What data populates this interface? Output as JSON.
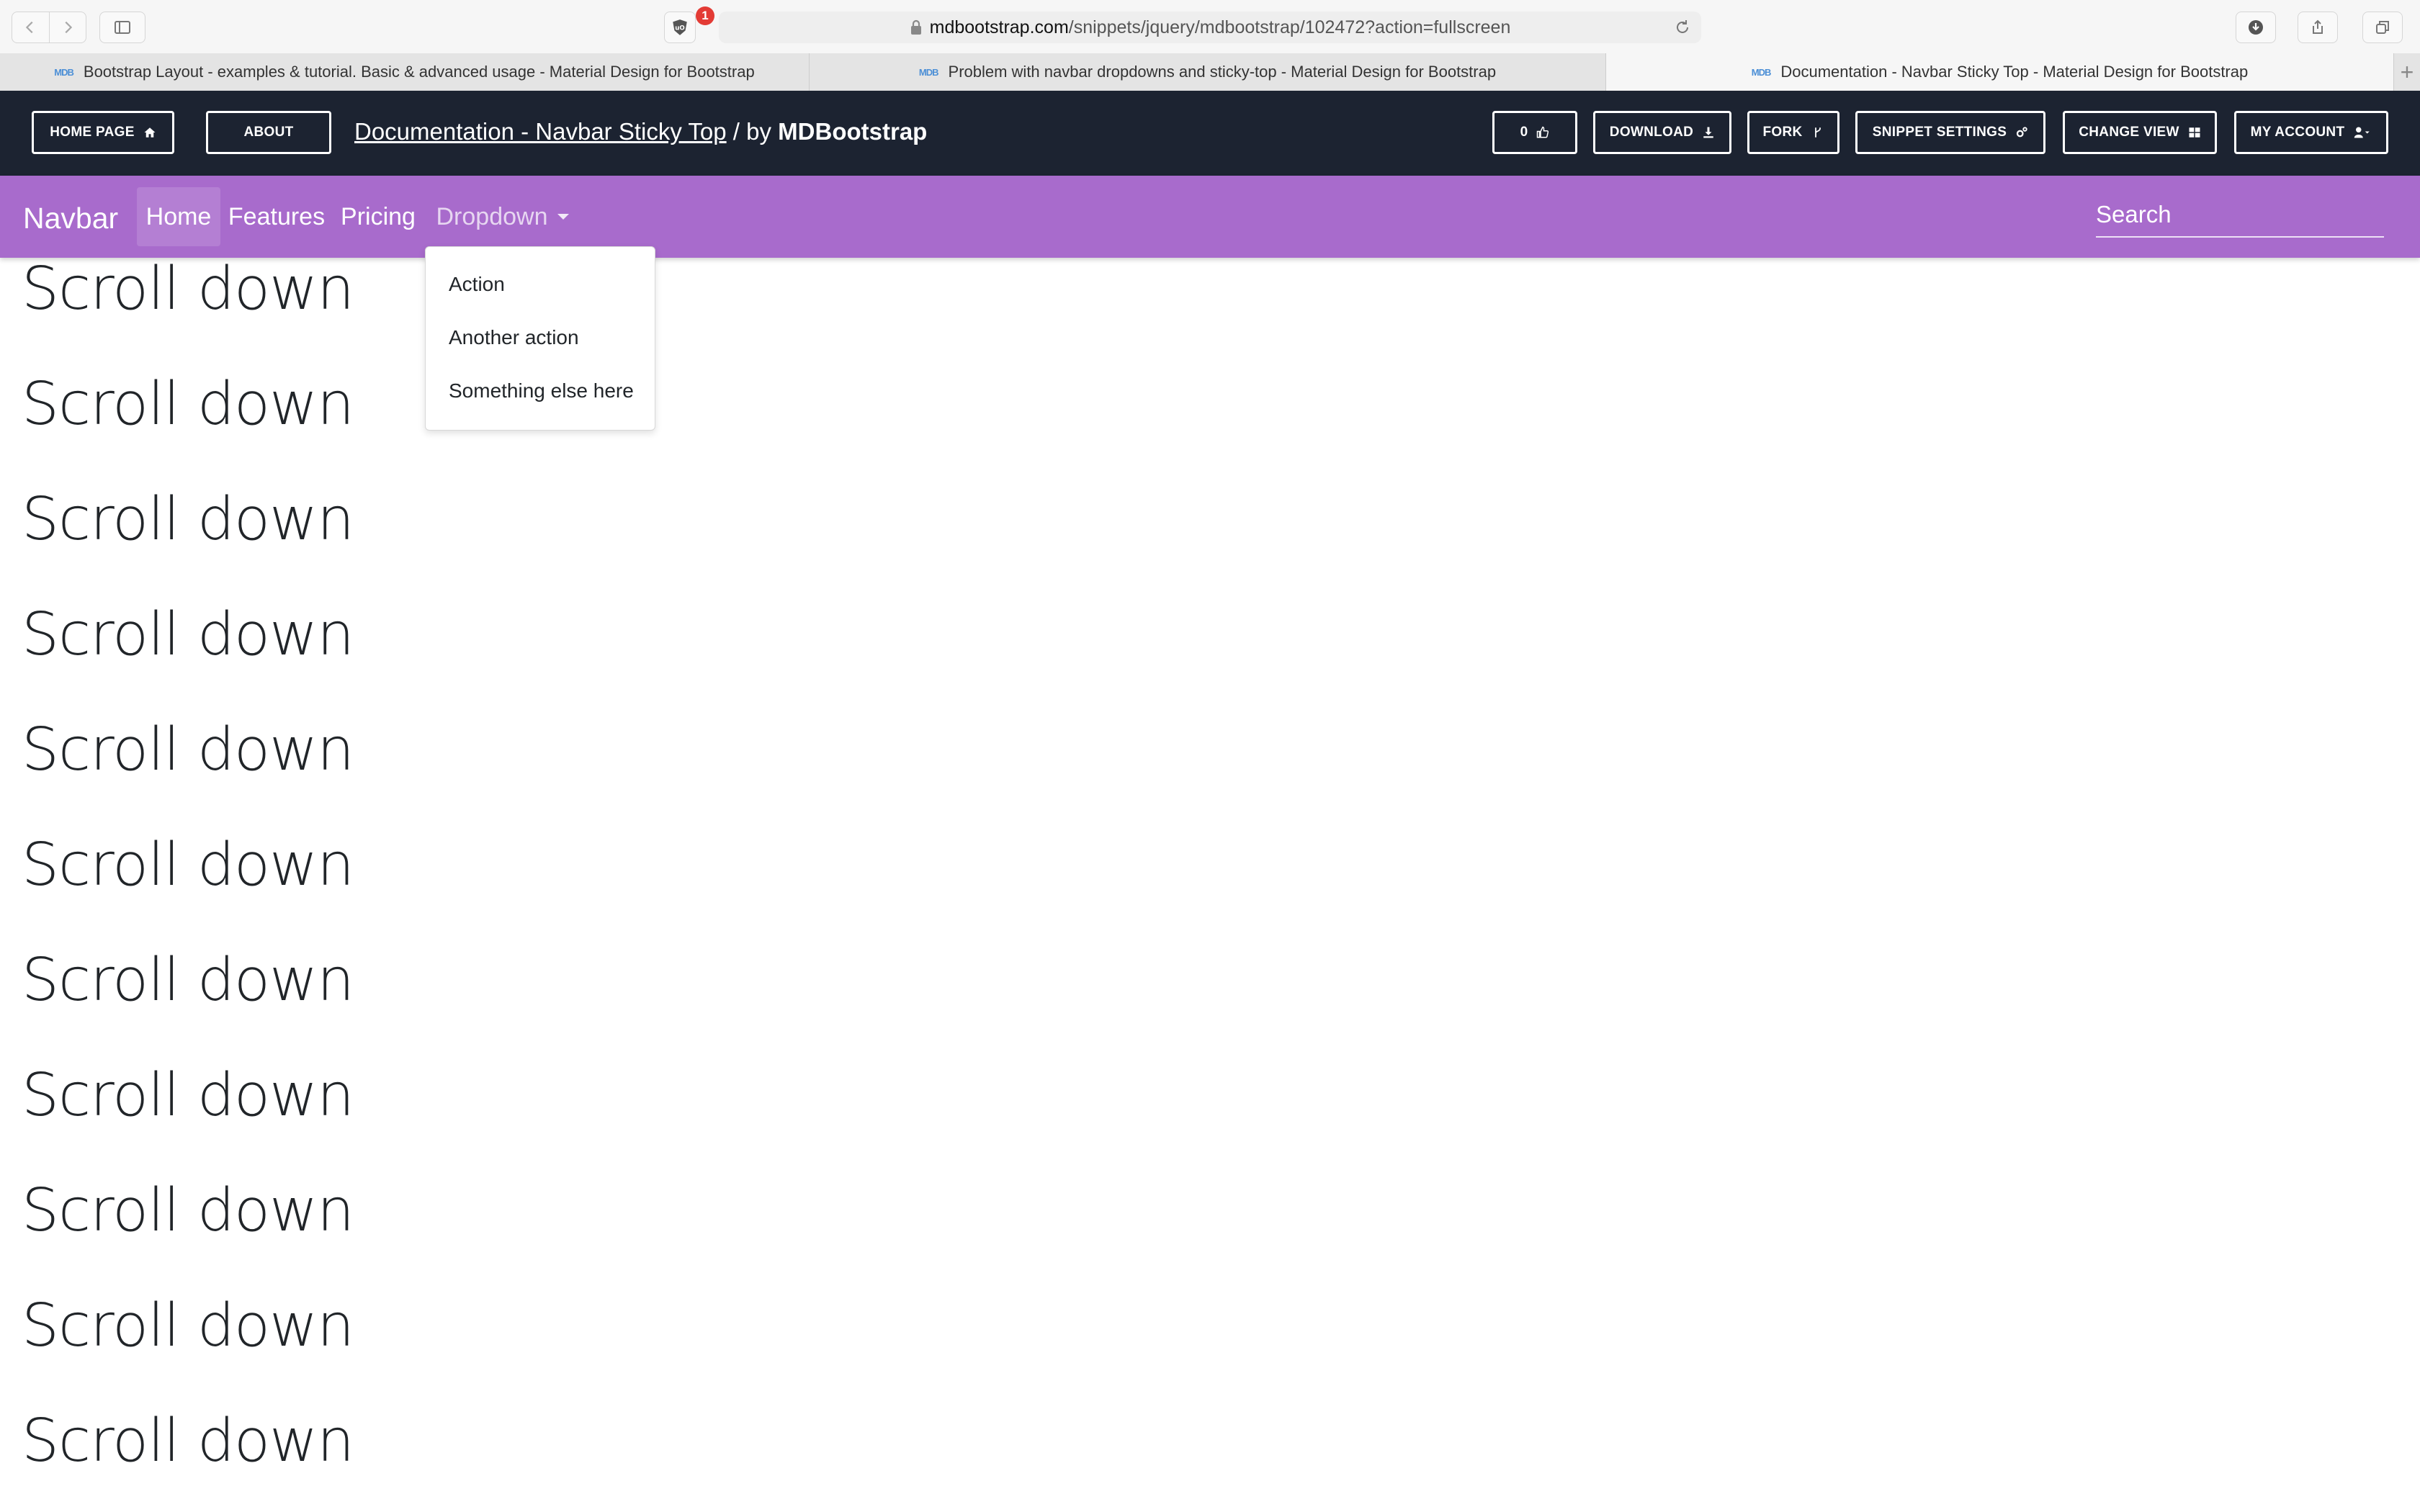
{
  "browser": {
    "extension_badge": "1",
    "url_domain": "mdbootstrap.com",
    "url_path": "/snippets/jquery/mdbootstrap/102472?action=fullscreen",
    "tabs": [
      {
        "title": "Bootstrap Layout - examples & tutorial. Basic & advanced usage - Material Design for Bootstrap",
        "favicon": "MDB"
      },
      {
        "title": "Problem with navbar dropdowns and sticky-top - Material Design for Bootstrap",
        "favicon": "MDB"
      },
      {
        "title": "Documentation - Navbar Sticky Top - Material Design for Bootstrap",
        "favicon": "MDB"
      }
    ],
    "new_tab_label": "+"
  },
  "toolbar": {
    "home_label": "HOME PAGE",
    "about_label": "ABOUT",
    "title_link": "Documentation - Navbar Sticky Top",
    "title_sep": "/ by",
    "title_author": "MDBootstrap",
    "likes_label": "0",
    "download_label": "DOWNLOAD",
    "fork_label": "FORK",
    "settings_label": "SNIPPET SETTINGS",
    "change_view_label": "CHANGE VIEW",
    "account_label": "MY ACCOUNT"
  },
  "navbar": {
    "brand": "Navbar",
    "items": [
      "Home",
      "Features",
      "Pricing",
      "Dropdown"
    ],
    "active_item": "Home",
    "search_placeholder": "Search"
  },
  "dropdown": {
    "items": [
      "Action",
      "Another action",
      "Something else here"
    ]
  },
  "content": {
    "lines": [
      "Scroll down",
      "Scroll down",
      "Scroll down",
      "Scroll down",
      "Scroll down",
      "Scroll down",
      "Scroll down",
      "Scroll down",
      "Scroll down",
      "Scroll down",
      "Scroll down"
    ]
  },
  "colors": {
    "toolbar_bg": "#1c2331",
    "navbar_bg": "#a86bcc",
    "badge": "#e33b35"
  },
  "icons": [
    "chevron-left-icon",
    "chevron-right-icon",
    "sidebar-icon",
    "shield-icon",
    "lock-icon",
    "reload-icon",
    "download-icon",
    "share-icon",
    "tabs-icon",
    "home-icon",
    "thumbs-up-icon",
    "download-arrow-icon",
    "fork-icon",
    "cogs-icon",
    "grid-icon",
    "user-icon"
  ]
}
